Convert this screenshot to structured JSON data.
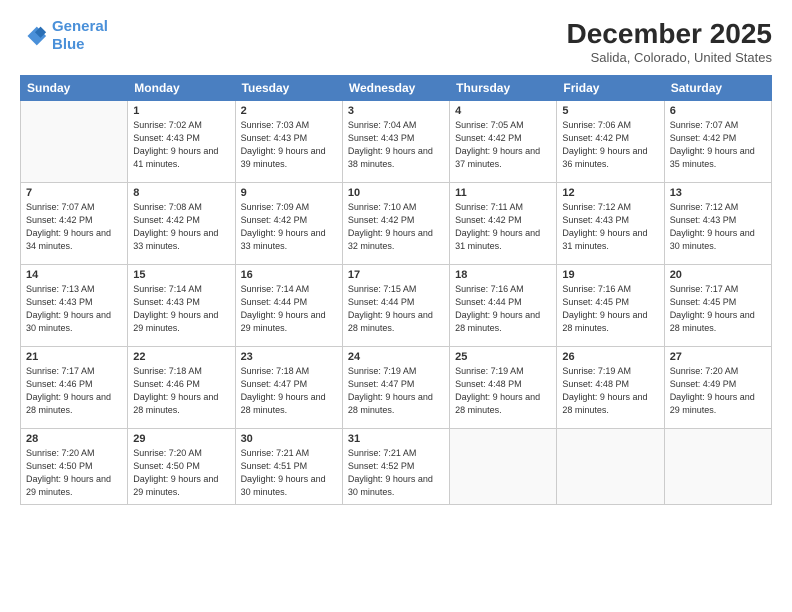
{
  "logo": {
    "line1": "General",
    "line2": "Blue"
  },
  "title": "December 2025",
  "subtitle": "Salida, Colorado, United States",
  "days_of_week": [
    "Sunday",
    "Monday",
    "Tuesday",
    "Wednesday",
    "Thursday",
    "Friday",
    "Saturday"
  ],
  "weeks": [
    [
      {
        "num": "",
        "sunrise": "",
        "sunset": "",
        "daylight": "",
        "empty": true
      },
      {
        "num": "1",
        "sunrise": "7:02 AM",
        "sunset": "4:43 PM",
        "daylight": "9 hours and 41 minutes."
      },
      {
        "num": "2",
        "sunrise": "7:03 AM",
        "sunset": "4:43 PM",
        "daylight": "9 hours and 39 minutes."
      },
      {
        "num": "3",
        "sunrise": "7:04 AM",
        "sunset": "4:43 PM",
        "daylight": "9 hours and 38 minutes."
      },
      {
        "num": "4",
        "sunrise": "7:05 AM",
        "sunset": "4:42 PM",
        "daylight": "9 hours and 37 minutes."
      },
      {
        "num": "5",
        "sunrise": "7:06 AM",
        "sunset": "4:42 PM",
        "daylight": "9 hours and 36 minutes."
      },
      {
        "num": "6",
        "sunrise": "7:07 AM",
        "sunset": "4:42 PM",
        "daylight": "9 hours and 35 minutes."
      }
    ],
    [
      {
        "num": "7",
        "sunrise": "7:07 AM",
        "sunset": "4:42 PM",
        "daylight": "9 hours and 34 minutes."
      },
      {
        "num": "8",
        "sunrise": "7:08 AM",
        "sunset": "4:42 PM",
        "daylight": "9 hours and 33 minutes."
      },
      {
        "num": "9",
        "sunrise": "7:09 AM",
        "sunset": "4:42 PM",
        "daylight": "9 hours and 33 minutes."
      },
      {
        "num": "10",
        "sunrise": "7:10 AM",
        "sunset": "4:42 PM",
        "daylight": "9 hours and 32 minutes."
      },
      {
        "num": "11",
        "sunrise": "7:11 AM",
        "sunset": "4:42 PM",
        "daylight": "9 hours and 31 minutes."
      },
      {
        "num": "12",
        "sunrise": "7:12 AM",
        "sunset": "4:43 PM",
        "daylight": "9 hours and 31 minutes."
      },
      {
        "num": "13",
        "sunrise": "7:12 AM",
        "sunset": "4:43 PM",
        "daylight": "9 hours and 30 minutes."
      }
    ],
    [
      {
        "num": "14",
        "sunrise": "7:13 AM",
        "sunset": "4:43 PM",
        "daylight": "9 hours and 30 minutes."
      },
      {
        "num": "15",
        "sunrise": "7:14 AM",
        "sunset": "4:43 PM",
        "daylight": "9 hours and 29 minutes."
      },
      {
        "num": "16",
        "sunrise": "7:14 AM",
        "sunset": "4:44 PM",
        "daylight": "9 hours and 29 minutes."
      },
      {
        "num": "17",
        "sunrise": "7:15 AM",
        "sunset": "4:44 PM",
        "daylight": "9 hours and 28 minutes."
      },
      {
        "num": "18",
        "sunrise": "7:16 AM",
        "sunset": "4:44 PM",
        "daylight": "9 hours and 28 minutes."
      },
      {
        "num": "19",
        "sunrise": "7:16 AM",
        "sunset": "4:45 PM",
        "daylight": "9 hours and 28 minutes."
      },
      {
        "num": "20",
        "sunrise": "7:17 AM",
        "sunset": "4:45 PM",
        "daylight": "9 hours and 28 minutes."
      }
    ],
    [
      {
        "num": "21",
        "sunrise": "7:17 AM",
        "sunset": "4:46 PM",
        "daylight": "9 hours and 28 minutes."
      },
      {
        "num": "22",
        "sunrise": "7:18 AM",
        "sunset": "4:46 PM",
        "daylight": "9 hours and 28 minutes."
      },
      {
        "num": "23",
        "sunrise": "7:18 AM",
        "sunset": "4:47 PM",
        "daylight": "9 hours and 28 minutes."
      },
      {
        "num": "24",
        "sunrise": "7:19 AM",
        "sunset": "4:47 PM",
        "daylight": "9 hours and 28 minutes."
      },
      {
        "num": "25",
        "sunrise": "7:19 AM",
        "sunset": "4:48 PM",
        "daylight": "9 hours and 28 minutes."
      },
      {
        "num": "26",
        "sunrise": "7:19 AM",
        "sunset": "4:48 PM",
        "daylight": "9 hours and 28 minutes."
      },
      {
        "num": "27",
        "sunrise": "7:20 AM",
        "sunset": "4:49 PM",
        "daylight": "9 hours and 29 minutes."
      }
    ],
    [
      {
        "num": "28",
        "sunrise": "7:20 AM",
        "sunset": "4:50 PM",
        "daylight": "9 hours and 29 minutes."
      },
      {
        "num": "29",
        "sunrise": "7:20 AM",
        "sunset": "4:50 PM",
        "daylight": "9 hours and 29 minutes."
      },
      {
        "num": "30",
        "sunrise": "7:21 AM",
        "sunset": "4:51 PM",
        "daylight": "9 hours and 30 minutes."
      },
      {
        "num": "31",
        "sunrise": "7:21 AM",
        "sunset": "4:52 PM",
        "daylight": "9 hours and 30 minutes."
      },
      {
        "num": "",
        "sunrise": "",
        "sunset": "",
        "daylight": "",
        "empty": true
      },
      {
        "num": "",
        "sunrise": "",
        "sunset": "",
        "daylight": "",
        "empty": true
      },
      {
        "num": "",
        "sunrise": "",
        "sunset": "",
        "daylight": "",
        "empty": true
      }
    ]
  ]
}
